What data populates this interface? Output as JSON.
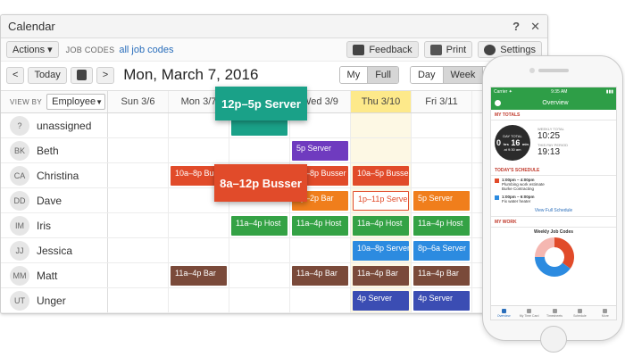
{
  "window": {
    "title": "Calendar",
    "help_label": "?",
    "close_label": "✕"
  },
  "toolbar": {
    "actions_label": "Actions ▾",
    "job_codes_label": "JOB CODES",
    "job_codes_link": "all job codes",
    "feedback_label": "Feedback",
    "print_label": "Print",
    "settings_label": "Settings"
  },
  "nav": {
    "prev_label": "<",
    "today_label": "Today",
    "next_label": ">",
    "date_title": "Mon, March 7, 2016",
    "scope": [
      "My",
      "Full"
    ],
    "scope_active": 1,
    "views": [
      "Day",
      "Week",
      "Month"
    ],
    "view_active": 1
  },
  "grid": {
    "view_by_label": "VIEW BY",
    "view_by_value": "Employee",
    "days": [
      "Sun  3/6",
      "Mon  3/7",
      "Tue  3/8",
      "Wed  3/9",
      "Thu  3/10",
      "Fri  3/11"
    ],
    "today_index": 4,
    "employees": [
      {
        "initials": "?",
        "name": "unassigned",
        "shifts": [
          {
            "day": 2,
            "label": "",
            "color": "#1aa188"
          }
        ]
      },
      {
        "initials": "BK",
        "name": "Beth",
        "shifts": [
          {
            "day": 3,
            "label": "5p Server",
            "color": "#6f3bbf"
          }
        ]
      },
      {
        "initials": "CA",
        "name": "Christina",
        "shifts": [
          {
            "day": 1,
            "label": "10a–8p Busser",
            "color": "#e14b2a"
          },
          {
            "day": 3,
            "label": "8a–8p Busser",
            "color": "#e14b2a"
          },
          {
            "day": 4,
            "label": "10a–5p Busser",
            "color": "#e14b2a"
          }
        ]
      },
      {
        "initials": "DD",
        "name": "Dave",
        "shifts": [
          {
            "day": 3,
            "label": "5p–2p Bar",
            "color": "#f07e1c"
          },
          {
            "day": 4,
            "label": "1p–11p Server",
            "color": "#e14b2a",
            "outline": true
          },
          {
            "day": 5,
            "label": "5p Server",
            "color": "#f07e1c"
          }
        ]
      },
      {
        "initials": "IM",
        "name": "Iris",
        "shifts": [
          {
            "day": 2,
            "label": "11a–4p Host",
            "color": "#34a245"
          },
          {
            "day": 3,
            "label": "11a–4p Host",
            "color": "#34a245"
          },
          {
            "day": 4,
            "label": "11a–4p Host",
            "color": "#34a245"
          },
          {
            "day": 5,
            "label": "11a–4p Host",
            "color": "#34a245"
          }
        ]
      },
      {
        "initials": "JJ",
        "name": "Jessica",
        "shifts": [
          {
            "day": 4,
            "label": "10a–8p Server",
            "color": "#2c8be0"
          },
          {
            "day": 5,
            "label": "8p–6a Server",
            "color": "#2c8be0"
          }
        ]
      },
      {
        "initials": "MM",
        "name": "Matt",
        "shifts": [
          {
            "day": 1,
            "label": "11a–4p Bar",
            "color": "#7a4a3a"
          },
          {
            "day": 3,
            "label": "11a–4p Bar",
            "color": "#7a4a3a"
          },
          {
            "day": 4,
            "label": "11a–4p Bar",
            "color": "#7a4a3a"
          },
          {
            "day": 5,
            "label": "11a–4p Bar",
            "color": "#7a4a3a"
          }
        ]
      },
      {
        "initials": "UT",
        "name": "Unger",
        "shifts": [
          {
            "day": 4,
            "label": "4p Server",
            "color": "#3b4db3"
          },
          {
            "day": 5,
            "label": "4p Server",
            "color": "#3b4db3"
          }
        ]
      }
    ],
    "drag_shifts": [
      {
        "label": "12p–5p Server",
        "color": "#1aa188"
      },
      {
        "label": "8a–12p Busser",
        "color": "#e14b2a"
      }
    ]
  },
  "phone": {
    "status_left": "Carrier ✦",
    "status_time": "9:35 AM",
    "status_right": "▮▮▮",
    "app_title": "Overview",
    "my_totals_title": "MY TOTALS",
    "day_total_label": "DAY TOTAL",
    "day_hours": "0",
    "day_minutes": "16",
    "hrs_label": "hrs",
    "min_label": "min",
    "since_label": "at 9:30 am",
    "weekly_total_label": "WEEKLY TOTAL",
    "weekly_total_value": "10:25",
    "pay_period_label": "THIS PAY PERIOD",
    "pay_period_value": "19:13",
    "schedule_title": "TODAY'S SCHEDULE",
    "schedule": [
      {
        "time": "1:00pm – 4:00pm",
        "desc": "Plumbing work estimate",
        "sub": "Burke Contracting",
        "color": "#e14b2a"
      },
      {
        "time": "1:00pm – 6:00pm",
        "desc": "Fix water heater",
        "sub": "",
        "color": "#2c8be0"
      }
    ],
    "schedule_link": "View Full Schedule",
    "my_work_title": "MY WORK",
    "chart_title": "Weekly Job Codes",
    "tabs": [
      "Overview",
      "My Time Card",
      "Timesheets",
      "Schedule",
      "More"
    ],
    "tab_active": 0
  },
  "chart_data": {
    "type": "pie",
    "title": "Weekly Job Codes",
    "values": [
      35,
      40,
      25
    ],
    "colors": [
      "#e14b2a",
      "#2c8be0",
      "#f5b7b1"
    ]
  }
}
